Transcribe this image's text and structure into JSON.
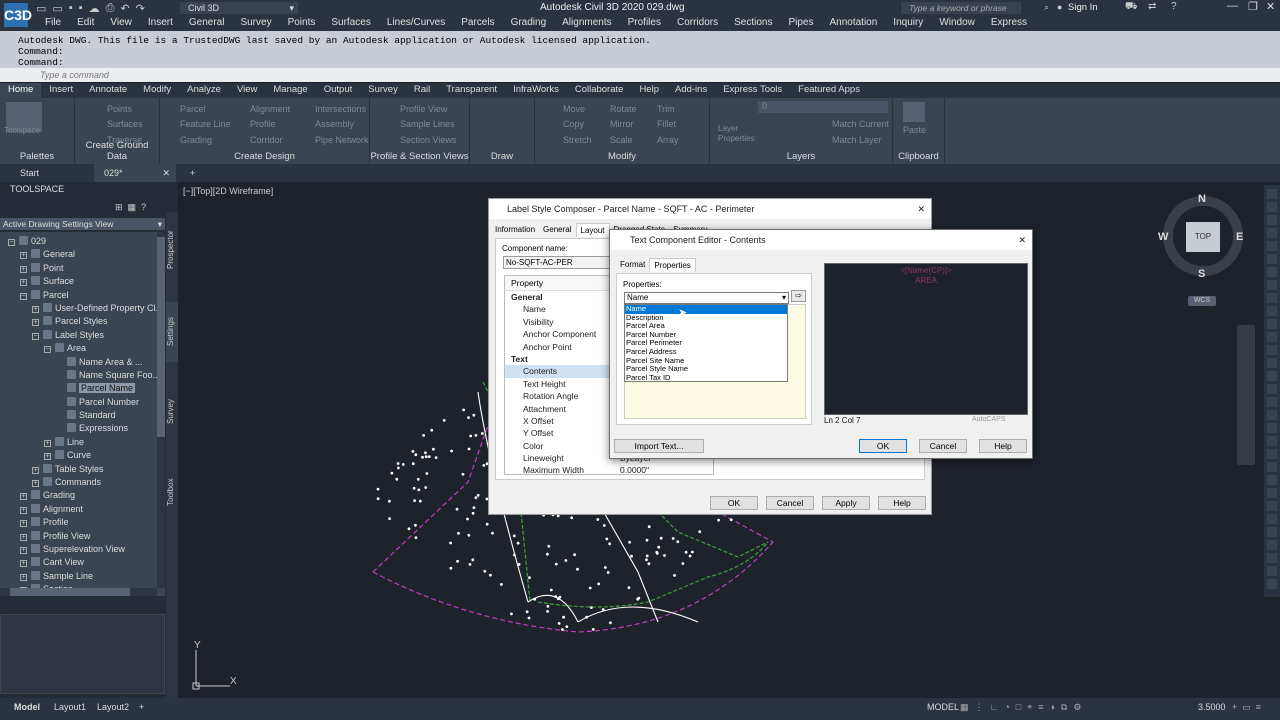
{
  "app": {
    "title": "Autodesk Civil 3D 2020    029.dwg",
    "workspace": "Civil 3D",
    "search_placeholder": "Type a keyword or phrase",
    "sign_in": "Sign In",
    "logo": "C3D"
  },
  "menu": [
    "File",
    "Edit",
    "View",
    "Insert",
    "General",
    "Survey",
    "Points",
    "Surfaces",
    "Lines/Curves",
    "Parcels",
    "Grading",
    "Alignments",
    "Profiles",
    "Corridors",
    "Sections",
    "Pipes",
    "Annotation",
    "Inquiry",
    "Window",
    "Express"
  ],
  "command": {
    "history": [
      "Autodesk DWG.  This file is a TrustedDWG last saved by an Autodesk application or Autodesk licensed application.",
      "Command:",
      "Command:"
    ],
    "placeholder": "Type a command"
  },
  "ribbon_tabs": [
    "Home",
    "Insert",
    "Annotate",
    "Modify",
    "Analyze",
    "View",
    "Manage",
    "Output",
    "Survey",
    "Rail",
    "Transparent",
    "InfraWorks",
    "Collaborate",
    "Help",
    "Add-ins",
    "Express Tools",
    "Featured Apps"
  ],
  "ribbon_panels": {
    "toolspace": "Toolspace",
    "palettes": "Palettes",
    "ground": [
      "Points",
      "Surfaces",
      "Traverse"
    ],
    "ground_label": "Create Ground Data",
    "design": [
      "Parcel",
      "Feature Line",
      "Grading",
      "Alignment",
      "Profile",
      "Corridor",
      "Intersections",
      "Assembly",
      "Pipe Network"
    ],
    "design_label": "Create Design",
    "profile": [
      "Profile View",
      "Sample Lines",
      "Section Views"
    ],
    "profile_label": "Profile & Section Views",
    "draw_label": "Draw",
    "modify": [
      "Move",
      "Copy",
      "Stretch",
      "Rotate",
      "Mirror",
      "Scale",
      "Trim",
      "Fillet",
      "Array"
    ],
    "modify_label": "Modify",
    "layers": [
      "Layer Properties",
      "Match Current",
      "Match Layer"
    ],
    "layer_value": "0",
    "layers_label": "Layers",
    "paste": "Paste",
    "clipboard_label": "Clipboard"
  },
  "file_tabs": [
    "Start",
    "029*"
  ],
  "viewport_label": "[−][Top][2D Wireframe]",
  "toolspace": {
    "title": "TOOLSPACE",
    "view": "Active Drawing Settings View",
    "side_tabs": [
      "Prospector",
      "Settings",
      "Survey",
      "Toolbox"
    ],
    "tree": [
      {
        "label": "029",
        "level": 0,
        "exp": "−"
      },
      {
        "label": "General",
        "level": 1,
        "exp": "+"
      },
      {
        "label": "Point",
        "level": 1,
        "exp": "+"
      },
      {
        "label": "Surface",
        "level": 1,
        "exp": "+"
      },
      {
        "label": "Parcel",
        "level": 1,
        "exp": "−"
      },
      {
        "label": "User-Defined Property Cl...",
        "level": 2,
        "exp": "+"
      },
      {
        "label": "Parcel Styles",
        "level": 2,
        "exp": "+"
      },
      {
        "label": "Label Styles",
        "level": 2,
        "exp": "−"
      },
      {
        "label": "Area",
        "level": 3,
        "exp": "−"
      },
      {
        "label": "Name Area & ...",
        "level": 4,
        "exp": ""
      },
      {
        "label": "Name Square Foo...",
        "level": 4,
        "exp": ""
      },
      {
        "label": "Parcel Name",
        "level": 4,
        "exp": "",
        "sel": true
      },
      {
        "label": "Parcel Number",
        "level": 4,
        "exp": ""
      },
      {
        "label": "Standard",
        "level": 4,
        "exp": ""
      },
      {
        "label": "Expressions",
        "level": 4,
        "exp": ""
      },
      {
        "label": "Line",
        "level": 3,
        "exp": "+"
      },
      {
        "label": "Curve",
        "level": 3,
        "exp": "+"
      },
      {
        "label": "Table Styles",
        "level": 2,
        "exp": "+"
      },
      {
        "label": "Commands",
        "level": 2,
        "exp": "+"
      },
      {
        "label": "Grading",
        "level": 1,
        "exp": "+"
      },
      {
        "label": "Alignment",
        "level": 1,
        "exp": "+"
      },
      {
        "label": "Profile",
        "level": 1,
        "exp": "+"
      },
      {
        "label": "Profile View",
        "level": 1,
        "exp": "+"
      },
      {
        "label": "Superelevation View",
        "level": 1,
        "exp": "+"
      },
      {
        "label": "Cant View",
        "level": 1,
        "exp": "+"
      },
      {
        "label": "Sample Line",
        "level": 1,
        "exp": "+"
      },
      {
        "label": "Section",
        "level": 1,
        "exp": "+"
      }
    ]
  },
  "lsc": {
    "title": "Label Style Composer - Parcel Name - SQFT - AC - Perimeter",
    "tabs": [
      "Information",
      "General",
      "Layout",
      "Dragged State",
      "Summary"
    ],
    "component_name_label": "Component name:",
    "component_name": "No-SQFT-AC-PER",
    "property_header": "Property",
    "rows": [
      {
        "label": "General",
        "group": true
      },
      {
        "label": "Name"
      },
      {
        "label": "Visibility"
      },
      {
        "label": "Anchor Component"
      },
      {
        "label": "Anchor Point"
      },
      {
        "label": "Text",
        "group": true
      },
      {
        "label": "Contents",
        "sel": true
      },
      {
        "label": "Text Height"
      },
      {
        "label": "Rotation Angle"
      },
      {
        "label": "Attachment"
      },
      {
        "label": "X Offset"
      },
      {
        "label": "Y Offset"
      },
      {
        "label": "Color"
      },
      {
        "label": "Lineweight",
        "value": "ByLayer"
      },
      {
        "label": "Maximum Width",
        "value": "0.0000\""
      }
    ],
    "ok": "OK",
    "cancel": "Cancel",
    "apply": "Apply",
    "help": "Help"
  },
  "tce": {
    "title": "Text Component Editor - Contents",
    "tabs": [
      "Format",
      "Properties"
    ],
    "properties_label": "Properties:",
    "selected": "Name",
    "options": [
      "Name",
      "Description",
      "Parcel Area",
      "Parcel Number",
      "Parcel Perimeter",
      "Parcel Address",
      "Parcel Site Name",
      "Parcel Style Name",
      "Parcel Tax ID"
    ],
    "preview_text": [
      "<[Name(CP)]>",
      "AREA"
    ],
    "status": "Ln 2 Col 7",
    "caps": "AutoCAPS",
    "import_text": "Import Text...",
    "ok": "OK",
    "cancel": "Cancel",
    "help": "Help"
  },
  "viewcube": {
    "n": "N",
    "s": "S",
    "e": "E",
    "w": "W",
    "top": "TOP",
    "wcs": "WCS"
  },
  "ucs": {
    "x": "X",
    "y": "Y"
  },
  "status": {
    "tabs": [
      "Model",
      "Layout1",
      "Layout2"
    ],
    "mode": "MODEL",
    "scale": "3.5000"
  },
  "colors": {
    "bg": "#1e222b",
    "accent": "#0078d7",
    "parcel_line": "#ffffff",
    "green_line": "#3b9b3b",
    "magenta_line": "#c040c0"
  }
}
